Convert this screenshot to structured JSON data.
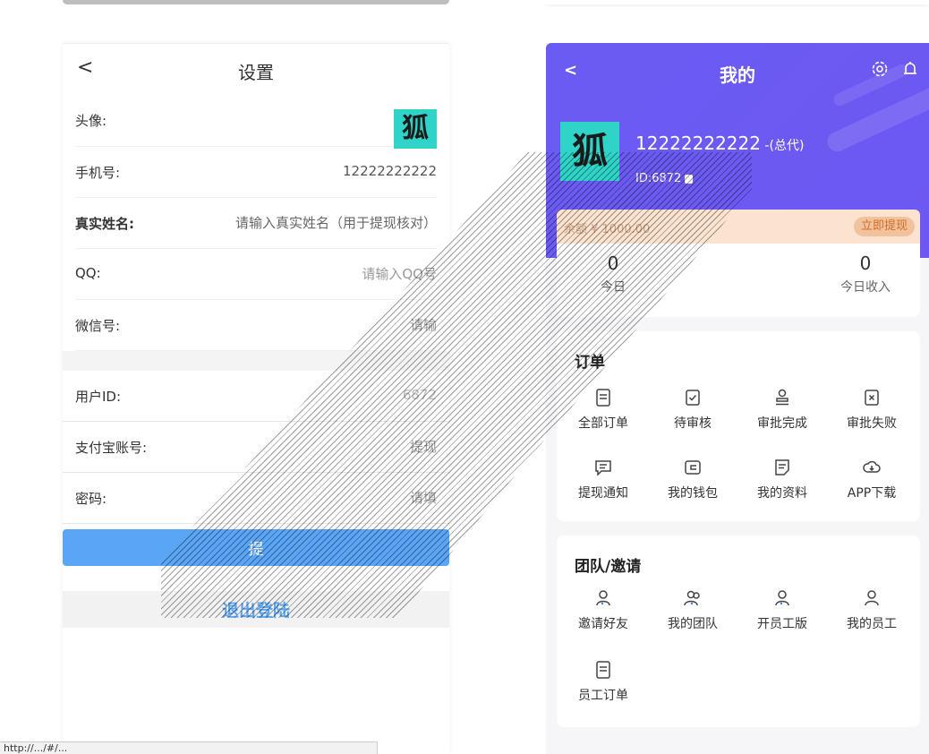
{
  "settings": {
    "back": "<",
    "title": "设置",
    "avatar_label": "头像:",
    "avatar_glyph": "狐",
    "phone_label": "手机号:",
    "phone_value": "12222222222",
    "realname_label": "真实姓名:",
    "realname_placeholder": "请输入真实姓名（用于提现核对）",
    "qq_label": "QQ:",
    "qq_placeholder": "请输入QQ号",
    "wechat_label": "微信号:",
    "wechat_placeholder": "请输",
    "userid_label": "用户ID:",
    "userid_value": "6872",
    "alipay_label": "支付宝账号:",
    "alipay_placeholder": "提现",
    "password_label": "密码:",
    "password_placeholder": "请填",
    "save_label": "提",
    "logout_label": "退出登陆"
  },
  "mine": {
    "back": "<",
    "title": "我的",
    "avatar_glyph": "狐",
    "phone": "12222222222",
    "role": " -(总代)",
    "id_text": "ID:6872",
    "balance_text": "余额 ¥ 1000.00",
    "withdraw_label": "立即提现",
    "stats": [
      {
        "value": "0",
        "label": "今日"
      },
      {
        "value": "0",
        "label": "今日收入"
      }
    ],
    "orders": {
      "title": "订单",
      "items": [
        {
          "label": "全部订单",
          "icon": "order-list-icon"
        },
        {
          "label": "待审核",
          "icon": "pending-review-icon"
        },
        {
          "label": "审批完成",
          "icon": "stamp-icon"
        },
        {
          "label": "审批失败",
          "icon": "rejected-icon"
        },
        {
          "label": "提现通知",
          "icon": "message-icon"
        },
        {
          "label": "我的钱包",
          "icon": "wallet-icon"
        },
        {
          "label": "我的资料",
          "icon": "profile-doc-icon"
        },
        {
          "label": "APP下载",
          "icon": "cloud-download-icon"
        }
      ]
    },
    "team": {
      "title": "团队/邀请",
      "items": [
        {
          "label": "邀请好友",
          "icon": "invite-friend-icon"
        },
        {
          "label": "我的团队",
          "icon": "team-icon"
        },
        {
          "label": "开员工版",
          "icon": "staff-open-icon"
        },
        {
          "label": "我的员工",
          "icon": "staff-icon"
        },
        {
          "label": "员工订单",
          "icon": "staff-order-icon"
        }
      ]
    }
  },
  "colors": {
    "header_purple": "#6a5cf3",
    "save_blue": "#5aa5f5",
    "avatar_teal": "#2fd3c7",
    "balance_bg": "#fbe3cf",
    "withdraw_text": "#d06d2a"
  },
  "status_url": "http://.../#/..."
}
